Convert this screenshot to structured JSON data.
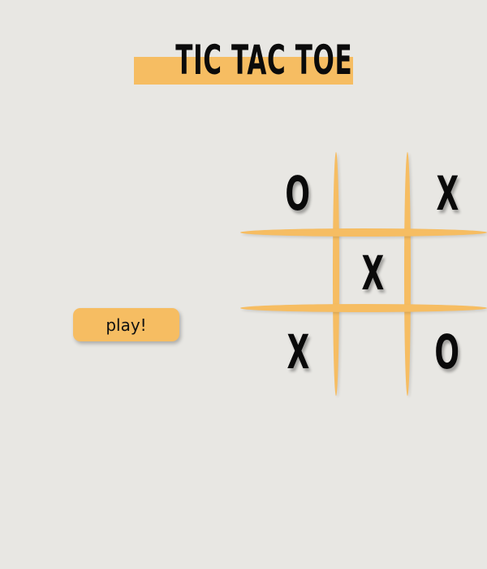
{
  "header": {
    "title": "TIC TAC TOE"
  },
  "controls": {
    "play_label": "play!"
  },
  "board": {
    "cells": [
      "O",
      "",
      "X",
      "",
      "X",
      "",
      "X",
      "",
      "O"
    ]
  },
  "colors": {
    "background": "#e8e7e3",
    "accent": "#f6bd62",
    "text": "#0b0b0b"
  }
}
